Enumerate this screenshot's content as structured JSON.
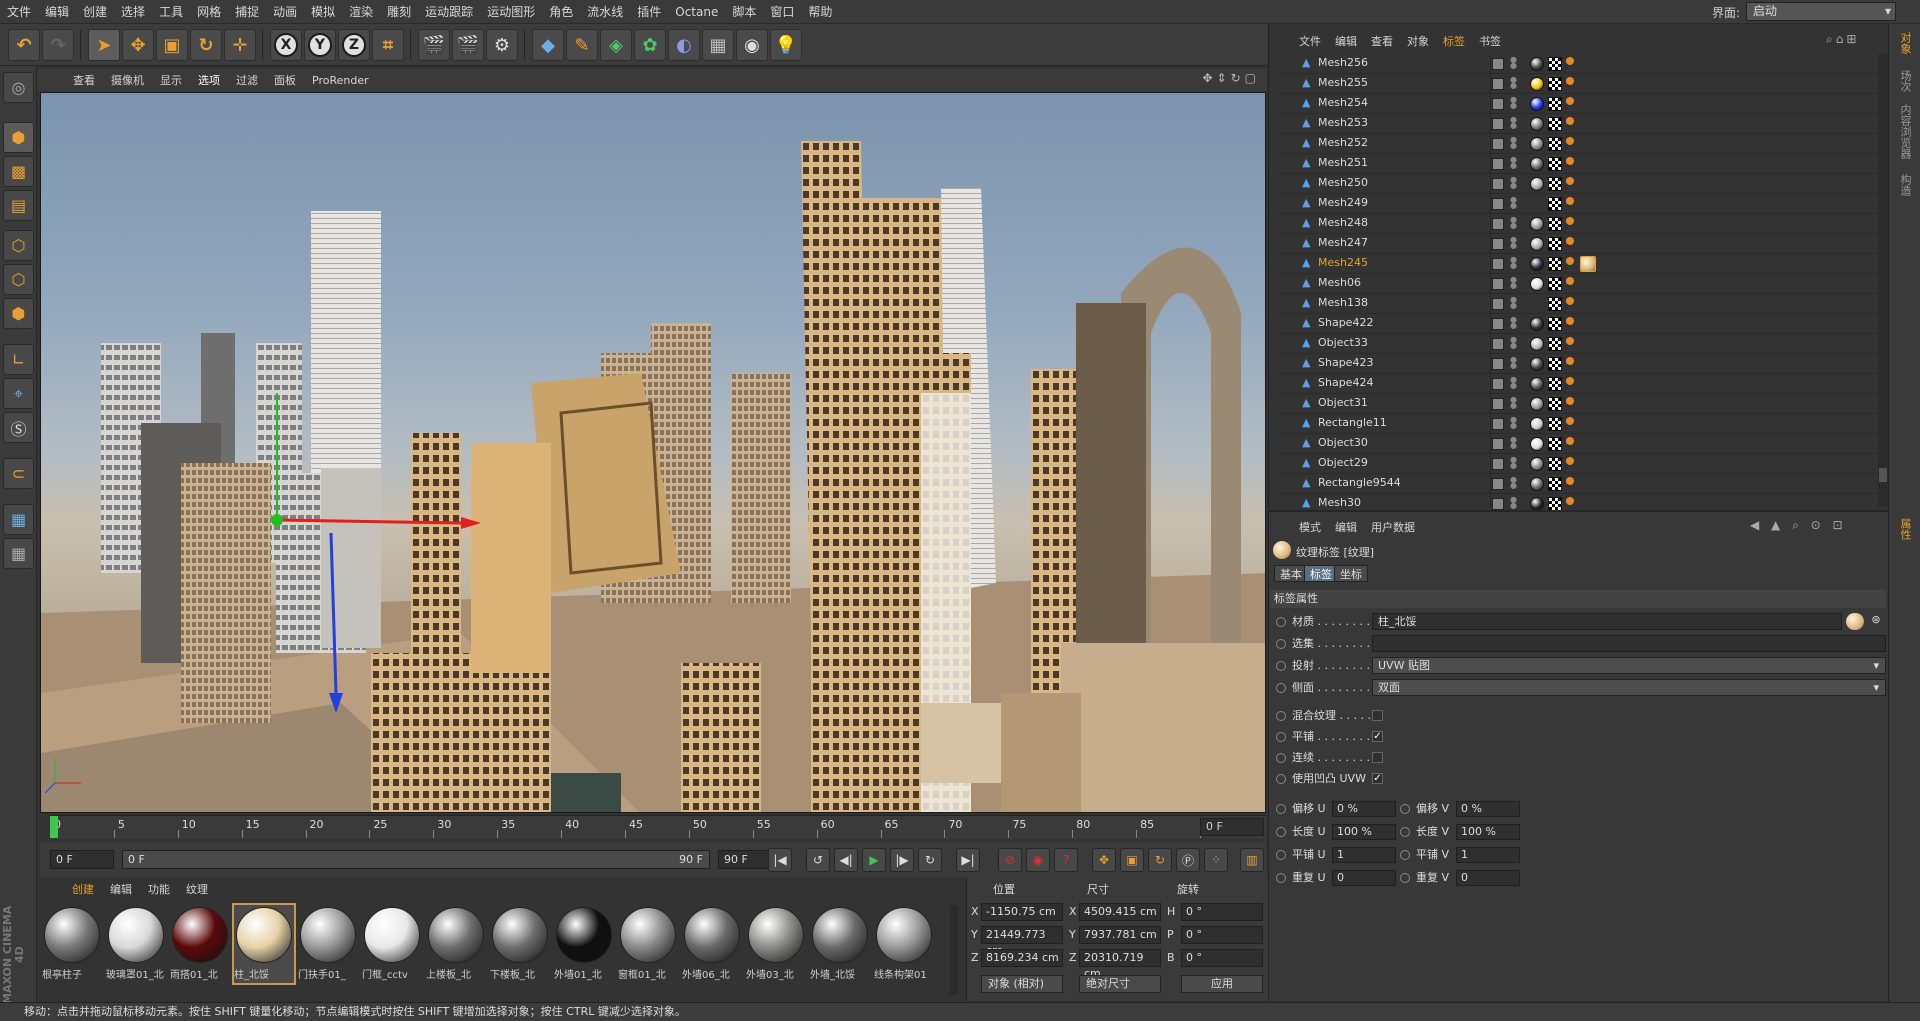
{
  "menubar": {
    "items": [
      "文件",
      "编辑",
      "创建",
      "选择",
      "工具",
      "网格",
      "捕捉",
      "动画",
      "模拟",
      "渲染",
      "雕刻",
      "运动跟踪",
      "运动图形",
      "角色",
      "流水线",
      "插件",
      "Octane",
      "脚本",
      "窗口",
      "帮助"
    ],
    "layout_label": "界面:",
    "layout_value": "启动"
  },
  "viewport": {
    "menu": [
      "查看",
      "摄像机",
      "显示",
      "选项",
      "过滤",
      "面板",
      "ProRender"
    ],
    "active": "选项"
  },
  "timeline": {
    "ticks": [
      "0",
      "5",
      "10",
      "15",
      "20",
      "25",
      "30",
      "35",
      "40",
      "45",
      "50",
      "55",
      "60",
      "65",
      "70",
      "75",
      "80",
      "85",
      "90"
    ],
    "current_frame": "0 F"
  },
  "transport": {
    "start": "0 F",
    "range_start": "0 F",
    "range_end": "90 F",
    "end": "90 F"
  },
  "materials": {
    "menu": [
      "创建",
      "编辑",
      "功能",
      "纹理"
    ],
    "items": [
      {
        "label": "根亭柱子",
        "color": "#7a7a7a"
      },
      {
        "label": "玻璃罩01_北",
        "color": "#d8d8d8"
      },
      {
        "label": "雨搭01_北",
        "color": "#5a0a0a"
      },
      {
        "label": "柱_北馁",
        "color": "#e6d2a8"
      },
      {
        "label": "门扶手01_",
        "color": "#9a9a9a"
      },
      {
        "label": "门框_cctv",
        "color": "#e8e8e8"
      },
      {
        "label": "上楼板_北",
        "color": "#6e6e6e"
      },
      {
        "label": "下楼板_北",
        "color": "#6e6e6e"
      },
      {
        "label": "外墙01_北",
        "color": "#101010"
      },
      {
        "label": "窗框01_北",
        "color": "#8a8a8a"
      },
      {
        "label": "外墙06_北",
        "color": "#6a6a6a"
      },
      {
        "label": "外墙03_北",
        "color": "#8c8c88"
      },
      {
        "label": "外墙_北馁",
        "color": "#6a6a6a"
      },
      {
        "label": "线条构架01",
        "color": "#9a9a9a"
      }
    ]
  },
  "coordinates": {
    "headers": [
      "位置",
      "尺寸",
      "旋转"
    ],
    "pos": {
      "x": "-1150.75 cm",
      "y": "21449.773 cm",
      "z": "8169.234 cm"
    },
    "size": {
      "x": "4509.415 cm",
      "y": "7937.781 cm",
      "z": "20310.719 cm"
    },
    "rot": {
      "h": "0 °",
      "p": "0 °",
      "b": "0 °"
    },
    "axis_labels": {
      "x": "X",
      "y": "Y",
      "z": "Z",
      "h": "H",
      "p": "P",
      "b": "B"
    },
    "mode": "对象 (相对)",
    "size_mode": "绝对尺寸",
    "apply": "应用"
  },
  "status": "移动：点击并拖动鼠标移动元素。按住 SHIFT 键量化移动；节点编辑模式时按住 SHIFT 键增加选择对象；按住 CTRL 键减少选择对象。",
  "objects": {
    "menu": [
      "文件",
      "编辑",
      "查看",
      "对象",
      "标签",
      "书签"
    ],
    "active": "标签",
    "rows": [
      {
        "name": "Mesh256",
        "ball": "#444"
      },
      {
        "name": "Mesh255",
        "ball": "#f2c400"
      },
      {
        "name": "Mesh254",
        "ball": "#1a3cf0"
      },
      {
        "name": "Mesh253",
        "ball": "#777"
      },
      {
        "name": "Mesh252",
        "ball": "#888"
      },
      {
        "name": "Mesh251",
        "ball": "#666"
      },
      {
        "name": "Mesh250",
        "ball": "#aaa"
      },
      {
        "name": "Mesh249",
        "ball": ""
      },
      {
        "name": "Mesh248",
        "ball": "#999"
      },
      {
        "name": "Mesh247",
        "ball": "#aaa"
      },
      {
        "name": "Mesh245",
        "ball": "#2a2a3a",
        "selected": true
      },
      {
        "name": "Mesh06",
        "ball": "#ddd"
      },
      {
        "name": "Mesh138",
        "ball": ""
      },
      {
        "name": "Shape422",
        "ball": "#333"
      },
      {
        "name": "Object33",
        "ball": "#bbb"
      },
      {
        "name": "Shape423",
        "ball": "#444"
      },
      {
        "name": "Shape424",
        "ball": "#555"
      },
      {
        "name": "Object31",
        "ball": "#999"
      },
      {
        "name": "Rectangle11",
        "ball": "#ccc"
      },
      {
        "name": "Object30",
        "ball": "#ddd"
      },
      {
        "name": "Object29",
        "ball": "#888"
      },
      {
        "name": "Rectangle9544",
        "ball": "#666"
      },
      {
        "name": "Mesh30",
        "ball": "#222"
      }
    ]
  },
  "attributes": {
    "menu": [
      "模式",
      "编辑",
      "用户数据"
    ],
    "title": "纹理标签 [纹理]",
    "tabs": [
      "基本",
      "标签",
      "坐标"
    ],
    "active_tab": "标签",
    "section": "标签属性",
    "material_label": "材质 . . . . . . . .",
    "material_value": "柱_北馁",
    "selection_label": "选集 . . . . . . . .",
    "selection_value": "",
    "projection_label": "投射 . . . . . . . .",
    "projection_value": "UVW 贴图",
    "side_label": "侧面 . . . . . . . .",
    "side_value": "双面",
    "mix_label": "混合纹理 . . . . . .",
    "tile_label": "平铺 . . . . . . . .",
    "seamless_label": "连续 . . . . . . . .",
    "bump_label": "使用凹凸 UVW",
    "offset_u_label": "偏移 U",
    "offset_u": "0 %",
    "offset_v_label": "偏移 V",
    "offset_v": "0 %",
    "length_u_label": "长度 U",
    "length_u": "100 %",
    "length_v_label": "长度 V",
    "length_v": "100 %",
    "tiles_u_label": "平铺 U",
    "tiles_u": "1",
    "tiles_v_label": "平铺 V",
    "tiles_v": "1",
    "repeat_u_label": "重复 U",
    "repeat_u": "0",
    "repeat_v_label": "重复 V",
    "repeat_v": "0"
  },
  "right_strip": [
    "对象",
    "场次",
    "内容浏览器",
    "构造"
  ],
  "right_strip_attr": "属性"
}
